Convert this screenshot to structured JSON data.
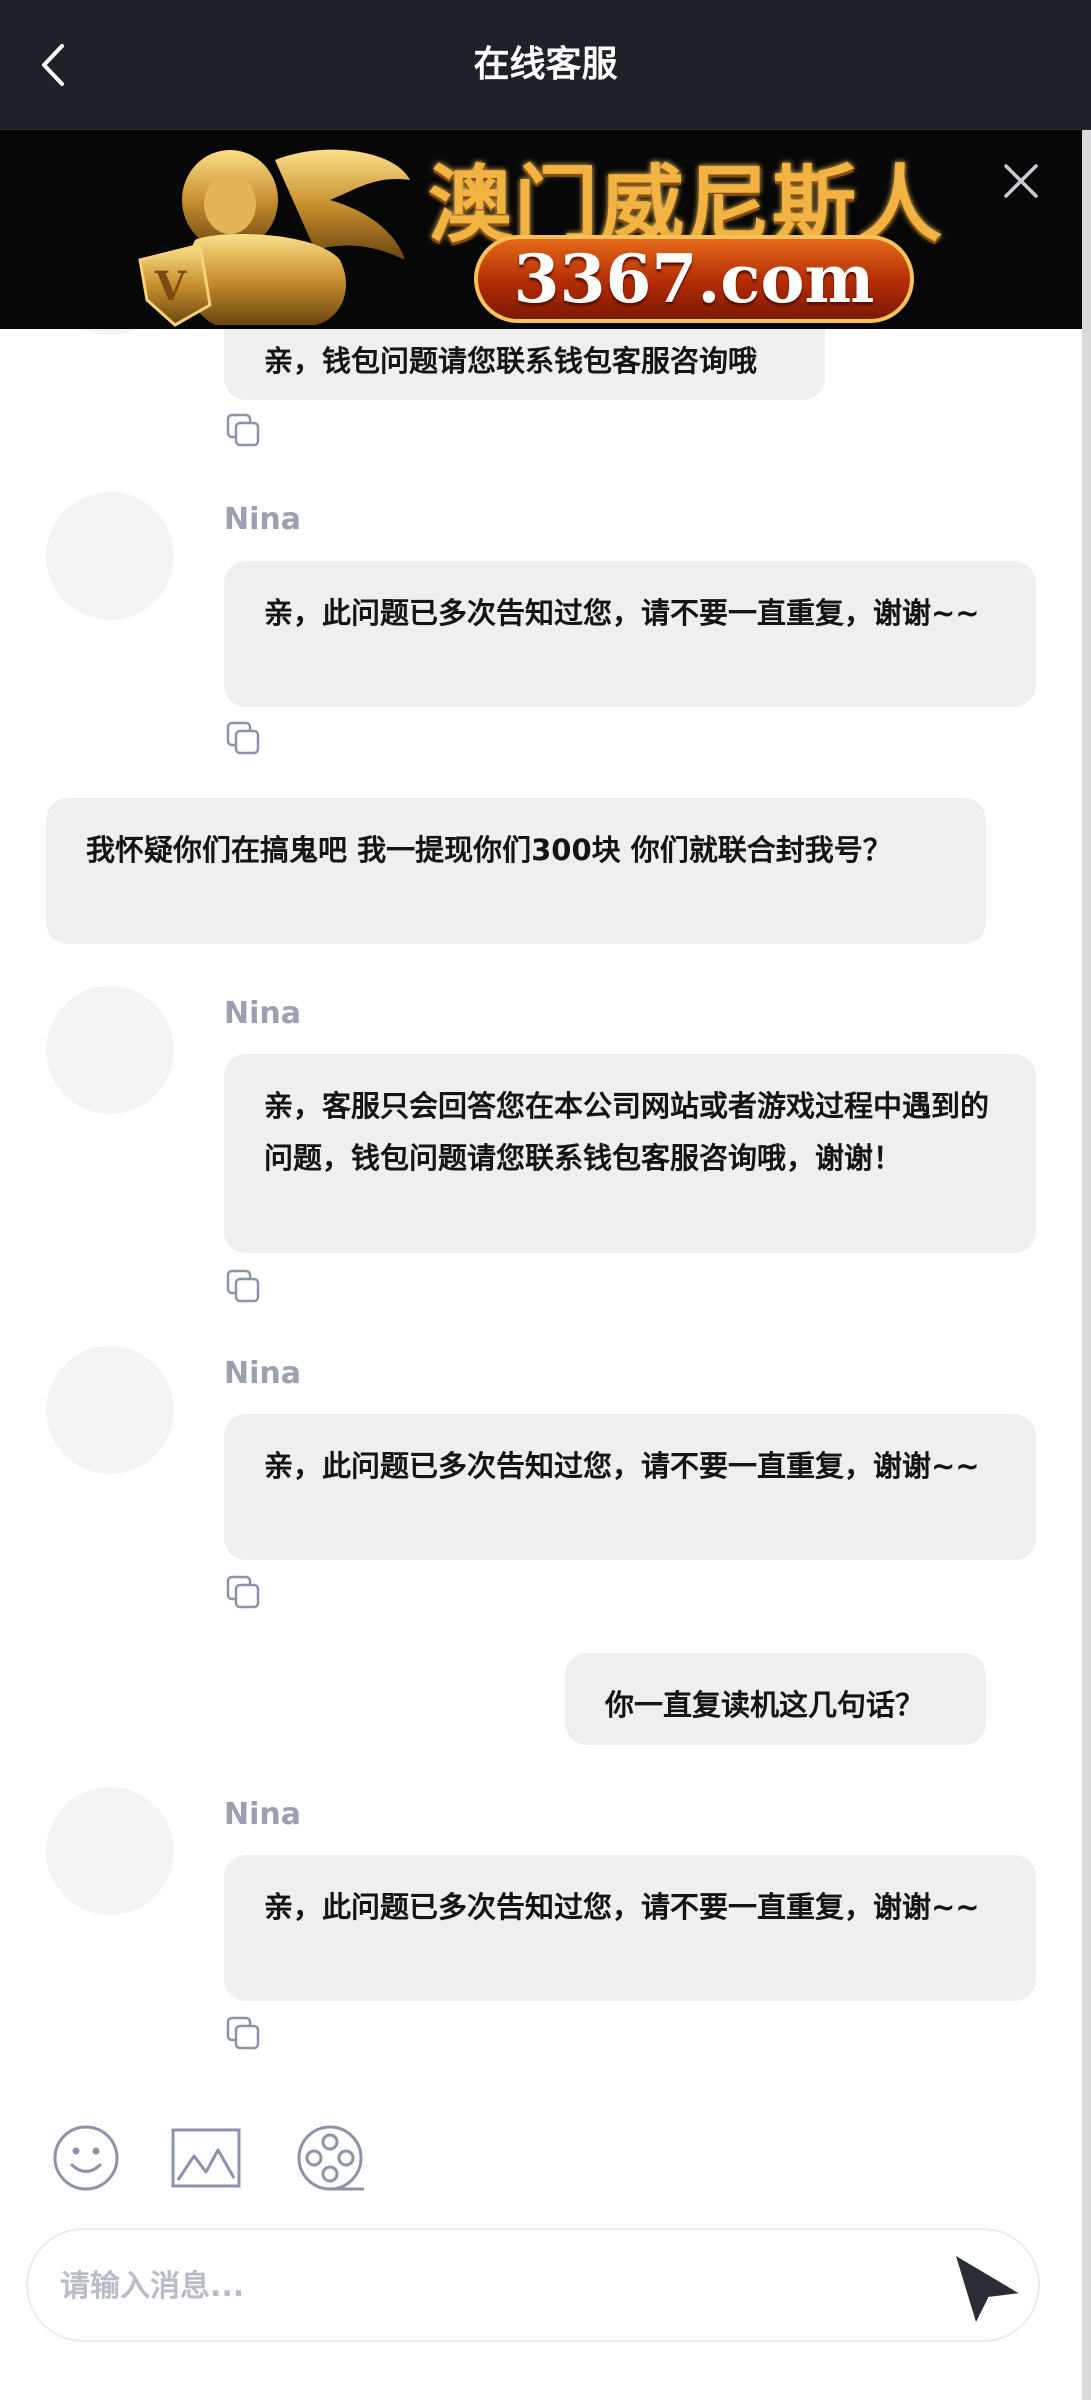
{
  "header": {
    "title": "在线客服"
  },
  "banner": {
    "brand": "澳门威尼斯人",
    "url": "3367.com"
  },
  "messages": [
    {
      "type": "agent",
      "text": "亲，钱包问题请您联系钱包客服咨询哦"
    },
    {
      "type": "agent",
      "name": "Nina",
      "text": "亲，此问题已多次告知过您，请不要一直重复，谢谢~~"
    },
    {
      "type": "user",
      "text": "我怀疑你们在搞鬼吧 我一提现你们300块 你们就联合封我号？"
    },
    {
      "type": "agent",
      "name": "Nina",
      "text": "亲，客服只会回答您在本公司网站或者游戏过程中遇到的问题，钱包问题请您联系钱包客服咨询哦，谢谢！"
    },
    {
      "type": "agent",
      "name": "Nina",
      "text": "亲，此问题已多次告知过您，请不要一直重复，谢谢~~"
    },
    {
      "type": "user",
      "text": "你一直复读机这几句话？"
    },
    {
      "type": "agent",
      "name": "Nina",
      "text": "亲，此问题已多次告知过您，请不要一直重复，谢谢~~"
    }
  ],
  "composer": {
    "placeholder": "请输入消息..."
  },
  "icons": {
    "back": "chevron-left-icon",
    "close": "close-icon",
    "avatar": "elephant-avatar-icon",
    "copy": "copy-icon",
    "emoji": "emoji-icon",
    "image": "image-icon",
    "video": "film-reel-icon",
    "send": "send-icon"
  },
  "colors": {
    "header_bg": "#1f2128",
    "bubble_bg": "#efefef",
    "name": "#9aa0b2",
    "icon": "#8c93a8"
  }
}
